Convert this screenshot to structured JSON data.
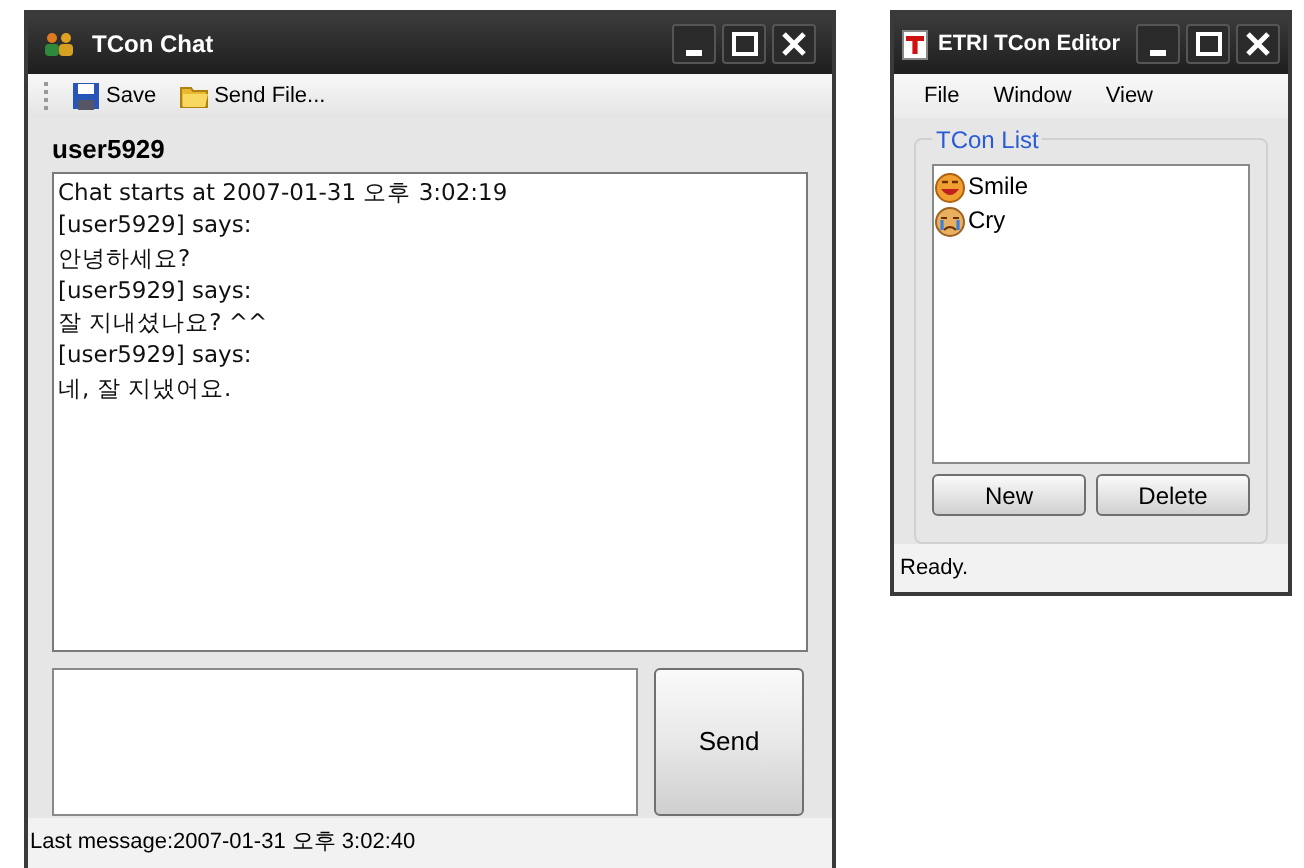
{
  "chat_window": {
    "title": "TCon Chat",
    "toolbar": [
      {
        "label": "Save",
        "kind": "save"
      },
      {
        "label": "Send File...",
        "kind": "folder"
      }
    ],
    "username": "user5929",
    "log": [
      "Chat starts at 2007-01-31 오후 3:02:19",
      "[user5929] says:",
      "안녕하세요?",
      "[user5929] says:",
      "잘 지내셨나요? ^^",
      "[user5929] says:",
      "네, 잘 지냈어요."
    ],
    "send_button": "Send",
    "status_bar": "Last message:2007-01-31 오후 3:02:40"
  },
  "editor_window": {
    "title": "ETRI TCon Editor",
    "menu": [
      "File",
      "Window",
      "View"
    ],
    "group_title": "TCon List",
    "tcons": [
      {
        "label": "Smile",
        "kind": "smile"
      },
      {
        "label": "Cry",
        "kind": "cry"
      }
    ],
    "buttons": [
      "New",
      "Delete"
    ],
    "status_bar": "Ready."
  }
}
